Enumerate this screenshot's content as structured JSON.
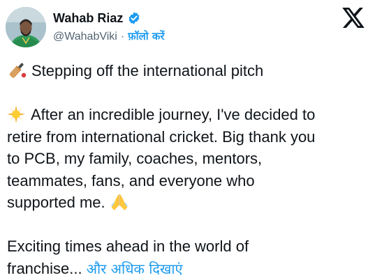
{
  "author": {
    "name": "Wahab Riaz",
    "handle": "@WahabViki",
    "separator": "·",
    "follow_label": "फ़ॉलो करें",
    "avatar_icon": "profile-photo",
    "verified_icon": "verified-badge-icon"
  },
  "platform_icon": "x-logo-icon",
  "tweet": {
    "line1": "Stepping off the international pitch",
    "line1_icon": "cricket-bat-icon",
    "para2_icon": "glowing-star-icon",
    "para2_lines": [
      "After an incredible journey, I've decided to",
      "retire from international cricket. Big thank you",
      "to PCB, my family, coaches, mentors,",
      "teammates, fans, and everyone who",
      "supported me."
    ],
    "para2_end_icon": "folded-hands-icon",
    "para3_lines": [
      "Exciting times ahead in the world of",
      "franchise..."
    ],
    "show_more_label": "और अधिक दिखाएं"
  },
  "colors": {
    "accent": "#1d9bf0",
    "text": "#0f1419",
    "secondary": "#536471"
  }
}
